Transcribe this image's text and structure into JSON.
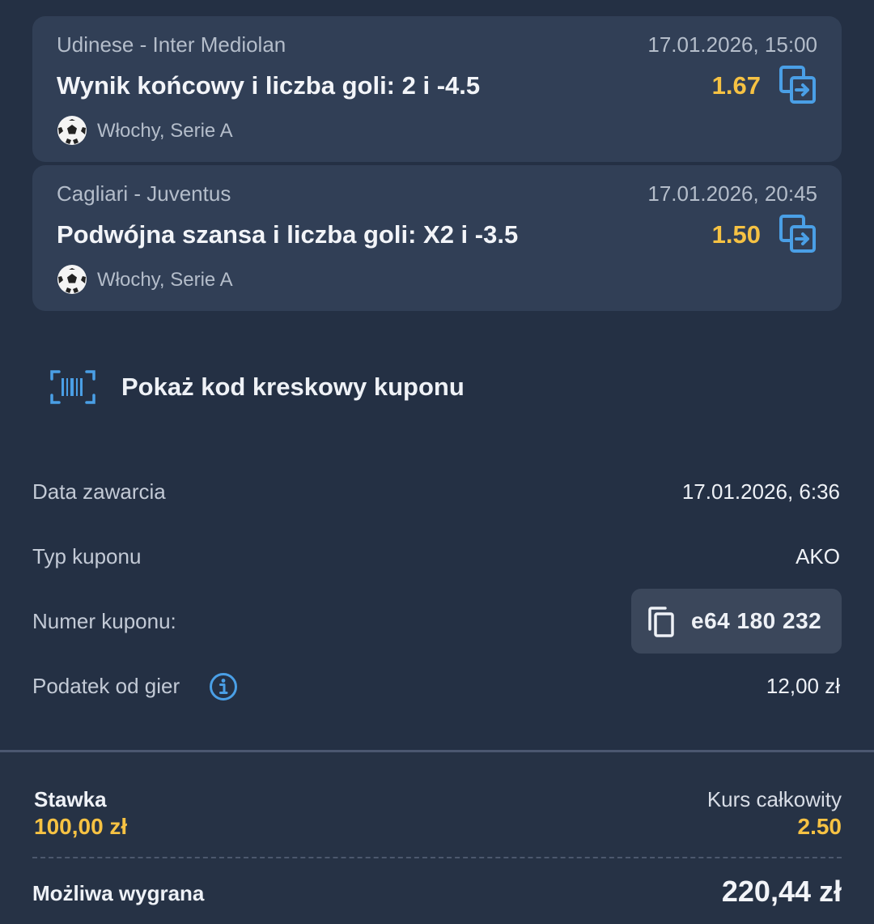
{
  "bets": [
    {
      "match": "Udinese - Inter Mediolan",
      "date": "17.01.2026, 15:00",
      "market": "Wynik końcowy i liczba goli: 2 i -4.5",
      "odds": "1.67",
      "league": "Włochy, Serie A"
    },
    {
      "match": "Cagliari - Juventus",
      "date": "17.01.2026, 20:45",
      "market": "Podwójna szansa i liczba goli: X2 i -3.5",
      "odds": "1.50",
      "league": "Włochy, Serie A"
    }
  ],
  "barcode": {
    "label": "Pokaż kod kreskowy kuponu"
  },
  "details": {
    "date_label": "Data zawarcia",
    "date_value": "17.01.2026, 6:36",
    "type_label": "Typ kuponu",
    "type_value": "AKO",
    "number_label": "Numer kuponu:",
    "number_value": "e64 180 232",
    "tax_label": "Podatek od gier",
    "tax_value": "12,00 zł"
  },
  "summary": {
    "stake_label": "Stawka",
    "stake_value": "100,00 zł",
    "total_odds_label": "Kurs całkowity",
    "total_odds_value": "2.50",
    "win_label": "Możliwa wygrana",
    "win_value": "220,44 zł"
  },
  "colors": {
    "background": "#243044",
    "card": "#313f56",
    "accent_gold": "#f6c243",
    "icon_blue": "#4a9fe6"
  },
  "icons": [
    "swap-icon",
    "football-icon",
    "barcode-icon",
    "copy-icon",
    "info-icon"
  ]
}
